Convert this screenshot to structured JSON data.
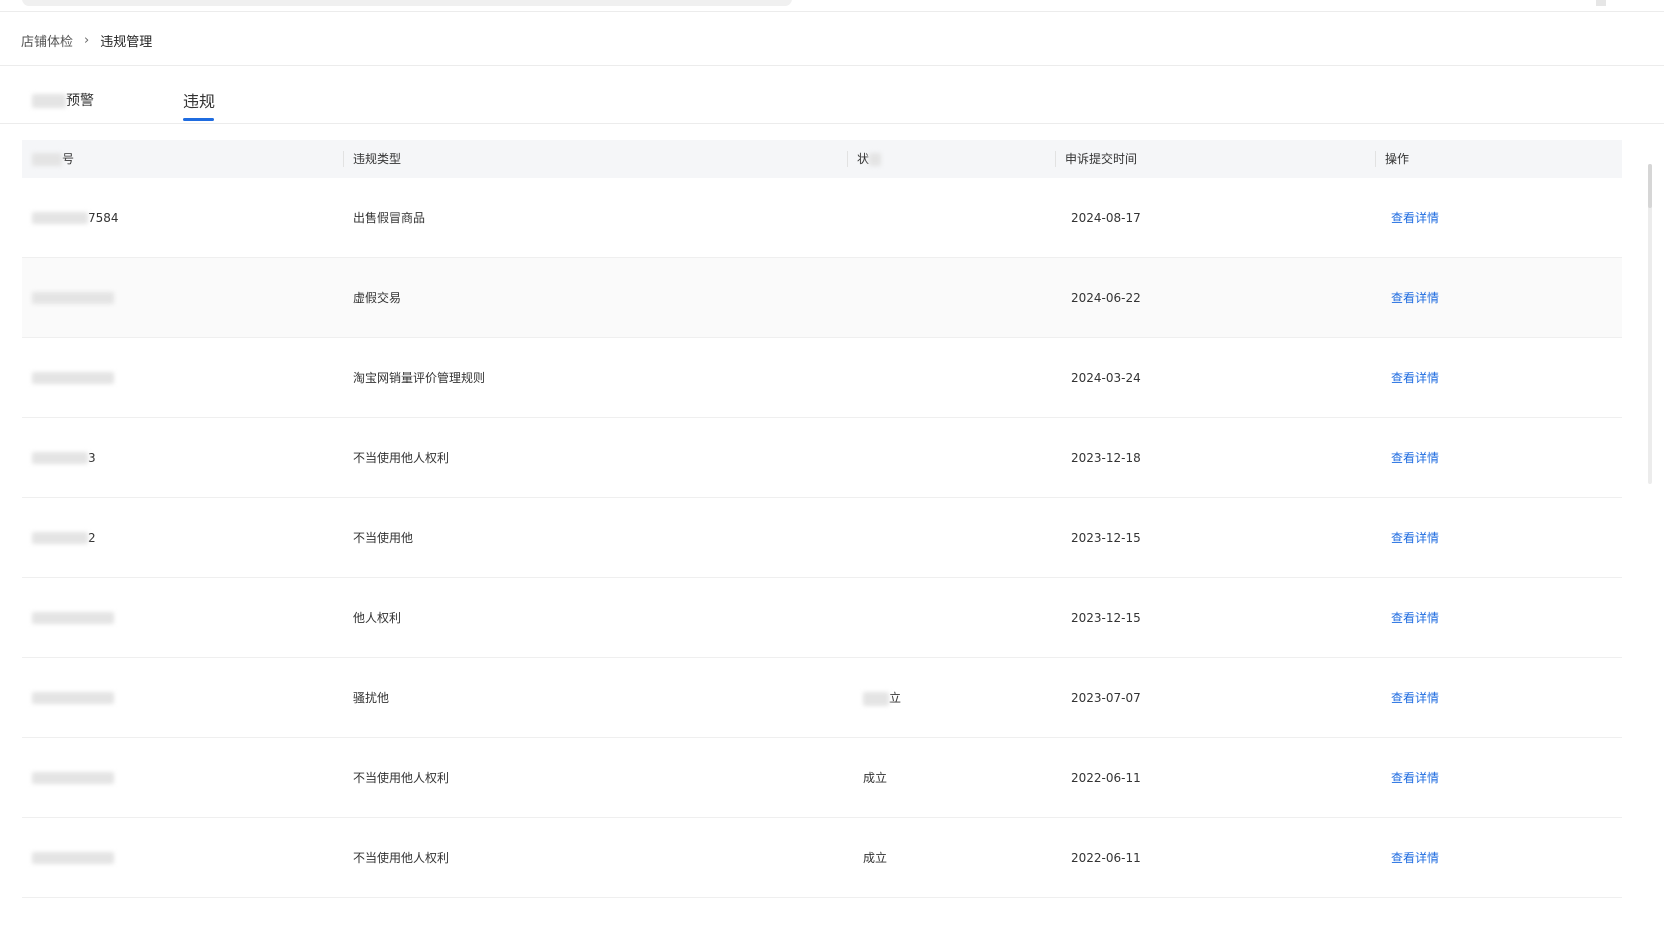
{
  "breadcrumb": {
    "parent": "店铺体检",
    "separator": "›",
    "current": "违规管理"
  },
  "tabs": [
    {
      "label": "预警",
      "active": false
    },
    {
      "label": "违规",
      "active": true
    }
  ],
  "table": {
    "columns": [
      "号",
      "违规类型",
      "状",
      "申诉提交时间",
      "操作"
    ],
    "rows": [
      {
        "id": "7584",
        "type": "出售假冒商品",
        "status": "",
        "date": "2024-08-17",
        "action": "查看详情"
      },
      {
        "id": "",
        "type": "虚假交易",
        "status": "",
        "date": "2024-06-22",
        "action": "查看详情"
      },
      {
        "id": "",
        "type": "淘宝网销量评价管理规则",
        "status": "",
        "date": "2024-03-24",
        "action": "查看详情"
      },
      {
        "id": "3",
        "type": "不当使用他人权利",
        "status": "",
        "date": "2023-12-18",
        "action": "查看详情"
      },
      {
        "id": "2",
        "type": "不当使用他",
        "status": "",
        "date": "2023-12-15",
        "action": "查看详情"
      },
      {
        "id": "",
        "type": "他人权利",
        "status": "",
        "date": "2023-12-15",
        "action": "查看详情"
      },
      {
        "id": "",
        "type": "骚扰他",
        "status": "立",
        "date": "2023-07-07",
        "action": "查看详情"
      },
      {
        "id": "",
        "type": "不当使用他人权利",
        "status": "成立",
        "date": "2022-06-11",
        "action": "查看详情"
      },
      {
        "id": "",
        "type": "不当使用他人权利",
        "status": "成立",
        "date": "2022-06-11",
        "action": "查看详情"
      }
    ]
  },
  "colors": {
    "accent": "#1f6ce0",
    "header_bg": "#f5f6f8",
    "divider": "#ececec"
  }
}
